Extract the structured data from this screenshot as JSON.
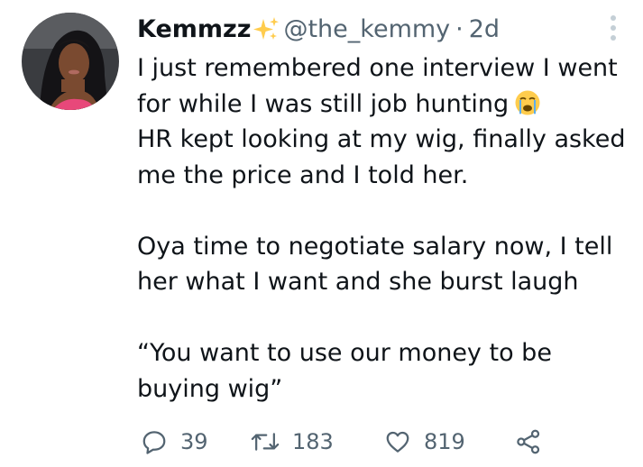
{
  "author": {
    "display_name": "Kemmzz",
    "handle": "@the_kemmy",
    "separator": "·",
    "time": "2d"
  },
  "tweet": {
    "lines": [
      "I just remembered one interview I went",
      "for while I was still job hunting",
      "HR kept looking at my wig, finally asked",
      "me the price and I told her.",
      "Oya time to negotiate salary now, I tell",
      "her what I want and she burst laugh",
      "“You want to use our money to be",
      "buying wig”"
    ]
  },
  "actions": {
    "replies": "39",
    "retweets": "183",
    "likes": "819"
  },
  "icons": {
    "name_emoji": "sparkles-icon",
    "text_emoji": "loudly-crying-face-icon",
    "reply": "reply-icon",
    "retweet": "retweet-icon",
    "like": "heart-icon",
    "share": "share-icon",
    "more": "more-options-icon"
  },
  "colors": {
    "text": "#0f1419",
    "secondary": "#536471",
    "icon": "#536471"
  }
}
